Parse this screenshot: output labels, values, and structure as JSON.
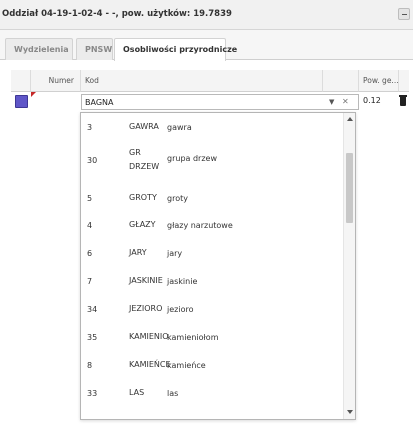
{
  "panel": {
    "title": "Oddział 04-19-1-02-4 - -, pow. użytków: 19.7839"
  },
  "tabs": [
    {
      "label": "Wydzielenia",
      "active": false
    },
    {
      "label": "PNSW",
      "active": false
    },
    {
      "label": "Osobliwości przyrodnicze",
      "active": true
    }
  ],
  "grid": {
    "columns": {
      "numer": "Numer",
      "kod": "Kod",
      "pow": "Pow. ge..."
    },
    "row": {
      "kod_value": "BAGNA",
      "pow_value": "0.12",
      "check_color": "#5f56c8",
      "flag_color": "#c62828"
    }
  },
  "dropdown": {
    "items": [
      {
        "code": "3",
        "short": "GAWRA",
        "long": "gawra"
      },
      {
        "code": "30",
        "short": "GR DRZEW",
        "long": "grupa drzew"
      },
      {
        "code": "5",
        "short": "GROTY",
        "long": "groty"
      },
      {
        "code": "4",
        "short": "GŁAZY",
        "long": "głazy narzutowe"
      },
      {
        "code": "6",
        "short": "JARY",
        "long": "jary"
      },
      {
        "code": "7",
        "short": "JASKINIE",
        "long": "jaskinie"
      },
      {
        "code": "34",
        "short": "JEZIORO",
        "long": "jezioro"
      },
      {
        "code": "35",
        "short": "KAMIENIO",
        "long": "kamieniołom"
      },
      {
        "code": "8",
        "short": "KAMIEŃCE",
        "long": "kamieńce"
      },
      {
        "code": "33",
        "short": "LAS",
        "long": "las"
      }
    ]
  },
  "icons": {
    "minimize": "minimize-icon",
    "combo_caret": "chevron-down-icon",
    "combo_clear": "close-icon",
    "delete": "trash-icon",
    "scroll_up": "arrow-up-icon",
    "scroll_down": "arrow-down-icon"
  }
}
